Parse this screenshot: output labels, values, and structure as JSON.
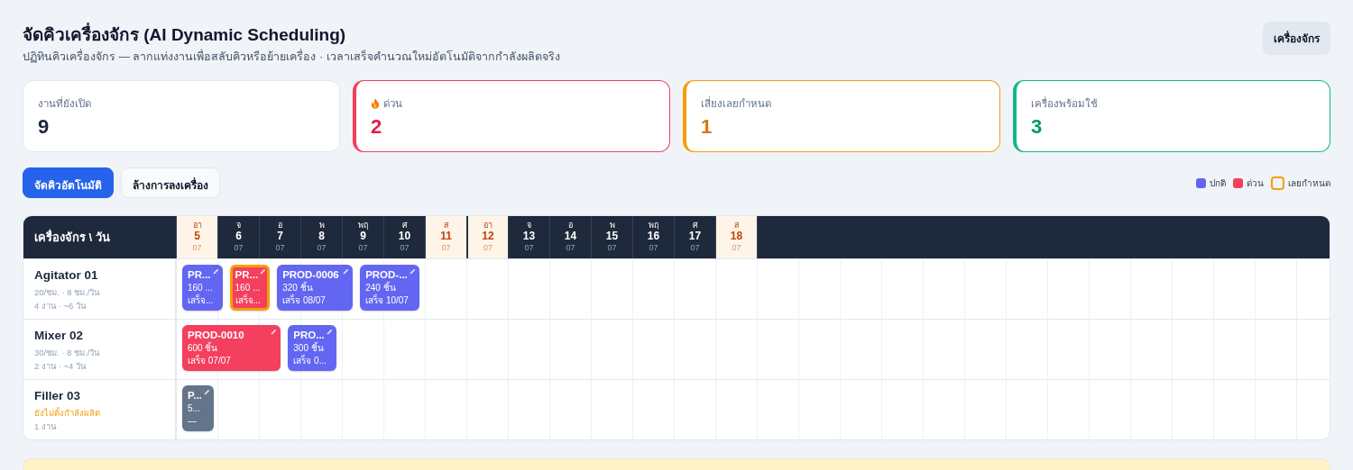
{
  "header": {
    "title": "จัดคิวเครื่องจักร (AI Dynamic Scheduling)",
    "subtitle": "ปฏิทินคิวเครื่องจักร — ลากแท่งงานเพื่อสลับคิวหรือย้ายเครื่อง · เวลาเสร็จคำนวณใหม่อัตโนมัติจากกำลังผลิตจริง",
    "button": "เครื่องจักร"
  },
  "stats": [
    {
      "label": "งานที่ยังเปิด",
      "value": "9",
      "kind": "neutral"
    },
    {
      "label": "ด่วน",
      "value": "2",
      "kind": "urgent"
    },
    {
      "label": "เสี่ยงเลยกำหนด",
      "value": "1",
      "kind": "warning"
    },
    {
      "label": "เครื่องพร้อมใช้",
      "value": "3",
      "kind": "ready"
    }
  ],
  "actions": [
    {
      "label": "จัดคิวอัตโนมัติ",
      "kind": "primary"
    },
    {
      "label": "ล้างการลงเครื่อง",
      "kind": "secondary"
    }
  ],
  "legend": [
    {
      "label": "ปกติ",
      "kind": "normal"
    },
    {
      "label": "ด่วน",
      "kind": "urgent"
    },
    {
      "label": "เลยกำหนด",
      "kind": "overdue"
    }
  ],
  "schedule": {
    "corner": "เครื่องจักร \\ วัน",
    "days": [
      {
        "weekday": "อา",
        "day": "5",
        "month": "07",
        "weekend": true,
        "week_start": false
      },
      {
        "weekday": "จ",
        "day": "6",
        "month": "07",
        "weekend": false,
        "week_start": false
      },
      {
        "weekday": "อ",
        "day": "7",
        "month": "07",
        "weekend": false,
        "week_start": false
      },
      {
        "weekday": "พ",
        "day": "8",
        "month": "07",
        "weekend": false,
        "week_start": false
      },
      {
        "weekday": "พฤ",
        "day": "9",
        "month": "07",
        "weekend": false,
        "week_start": false
      },
      {
        "weekday": "ศ",
        "day": "10",
        "month": "07",
        "weekend": false,
        "week_start": false
      },
      {
        "weekday": "ส",
        "day": "11",
        "month": "07",
        "weekend": true,
        "week_start": false
      },
      {
        "weekday": "อา",
        "day": "12",
        "month": "07",
        "weekend": true,
        "week_start": true
      },
      {
        "weekday": "จ",
        "day": "13",
        "month": "07",
        "weekend": false,
        "week_start": false
      },
      {
        "weekday": "อ",
        "day": "14",
        "month": "07",
        "weekend": false,
        "week_start": false
      },
      {
        "weekday": "พ",
        "day": "15",
        "month": "07",
        "weekend": false,
        "week_start": false
      },
      {
        "weekday": "พฤ",
        "day": "16",
        "month": "07",
        "weekend": false,
        "week_start": false
      },
      {
        "weekday": "ศ",
        "day": "17",
        "month": "07",
        "weekend": false,
        "week_start": false
      },
      {
        "weekday": "ส",
        "day": "18",
        "month": "07",
        "weekend": true,
        "week_start": false
      }
    ],
    "machines": [
      {
        "name": "Agitator 01",
        "capacity": "20/ชม. · 8 ชม./วัน",
        "capacity_missing": false,
        "load": "4 งาน · ~6 วัน",
        "jobs": [
          {
            "id": "PR...",
            "qty": "160 ...",
            "finish": "เสร็จ...",
            "kind": "normal",
            "overdue": false
          },
          {
            "id": "PR...",
            "qty": "160 ...",
            "finish": "เสร็จ...",
            "kind": "urgent",
            "overdue": true
          },
          {
            "id": "PROD-0006",
            "qty": "320 ชิ้น",
            "finish": "เสร็จ 08/07",
            "kind": "normal",
            "overdue": false
          },
          {
            "id": "PROD-...",
            "qty": "240 ชิ้น",
            "finish": "เสร็จ 10/07",
            "kind": "normal",
            "overdue": false
          }
        ]
      },
      {
        "name": "Mixer 02",
        "capacity": "30/ชม. · 8 ชม./วัน",
        "capacity_missing": false,
        "load": "2 งาน · ~4 วัน",
        "jobs": [
          {
            "id": "PROD-0010",
            "qty": "600 ชิ้น",
            "finish": "เสร็จ 07/07",
            "kind": "urgent",
            "overdue": false
          },
          {
            "id": "PRO...",
            "qty": "300 ชิ้น",
            "finish": "เสร็จ 0...",
            "kind": "normal",
            "overdue": false
          }
        ]
      },
      {
        "name": "Filler 03",
        "capacity": "ยังไม่ตั้งกำลังผลิต",
        "capacity_missing": true,
        "load": "1 งาน",
        "jobs": [
          {
            "id": "P...",
            "qty": "5...",
            "finish": "—",
            "kind": "idle",
            "overdue": false
          }
        ]
      }
    ]
  }
}
